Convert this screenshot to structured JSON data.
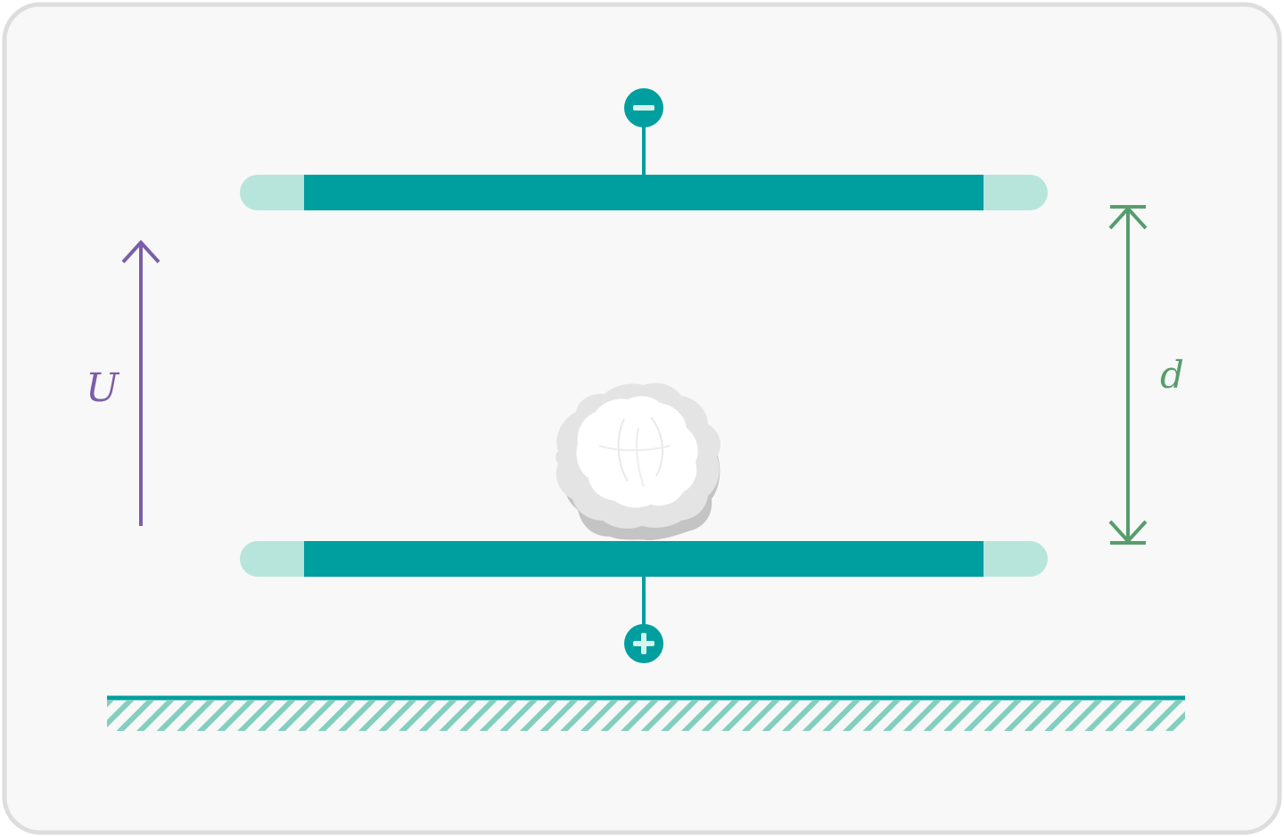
{
  "labels": {
    "voltage": "U",
    "distance": "d"
  },
  "terminals": {
    "top_sign": "negative",
    "bottom_sign": "positive"
  },
  "icons": {
    "top_terminal": "minus-terminal-icon",
    "bottom_terminal": "plus-terminal-icon",
    "particle": "dust-particle-icon",
    "ground": "ground-hatch-icon"
  },
  "colors": {
    "frame_border": "#dddddd",
    "frame_fill": "#f8f8f8",
    "plate_core": "#009f9f",
    "plate_end": "#b7e5db",
    "terminal_sign": "#d6f2ec",
    "voltage_arrow": "#7b5ea7",
    "distance_arrow": "#559e6b",
    "ground_line": "#009f9f",
    "ground_hatch": "#83cfbf",
    "particle_light": "#ffffff",
    "particle_mid": "#e4e4e4",
    "particle_shadow": "#c4c4c4"
  }
}
